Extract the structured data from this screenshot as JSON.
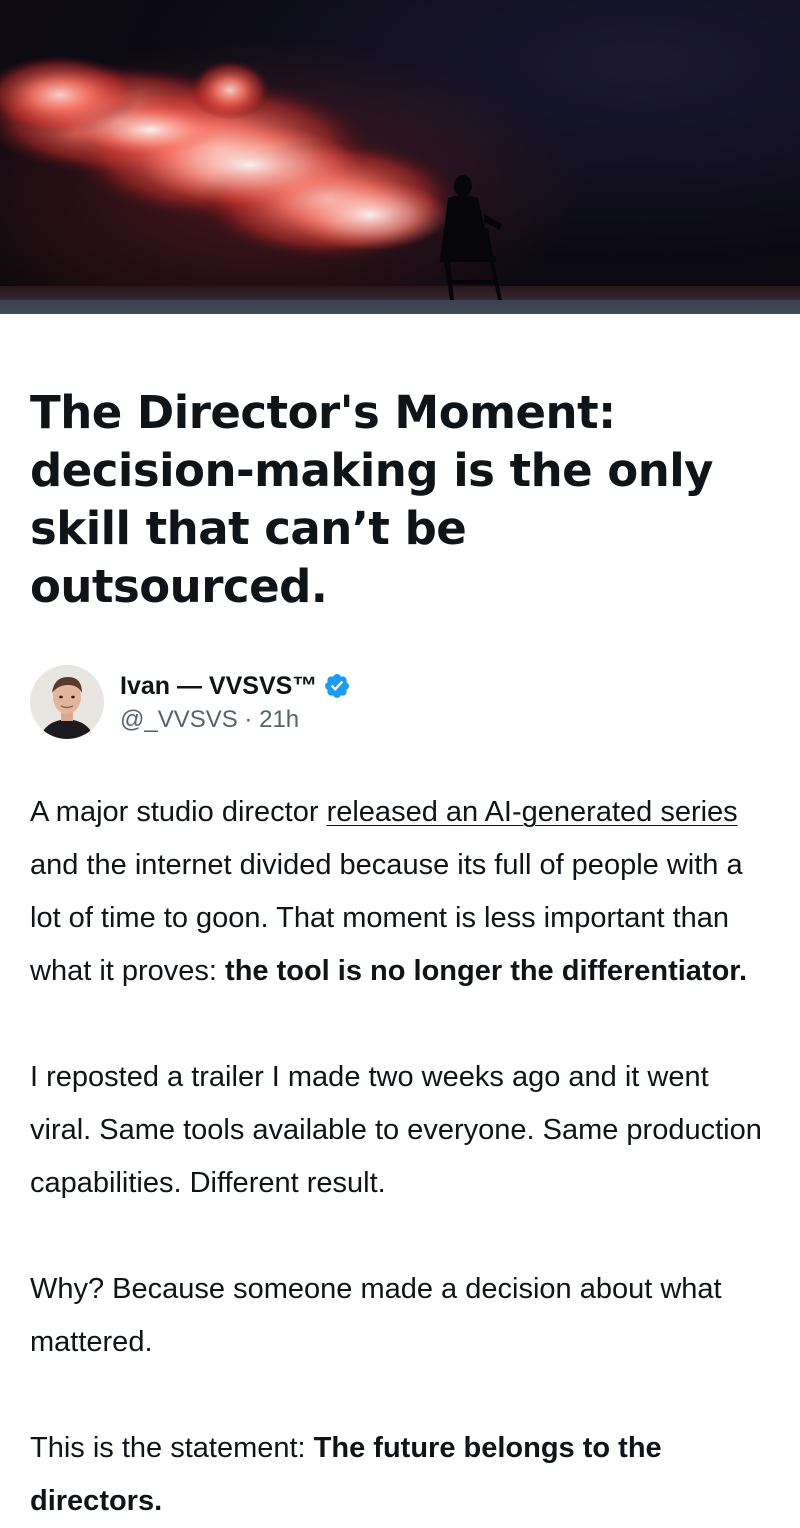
{
  "article": {
    "title": "The Director's Moment: decision-making is the only skill that can’t be outsourced.",
    "author": {
      "name": "Ivan — VVSVS™",
      "handle": "@_VVSVS",
      "separator": "·",
      "time": "21h",
      "verified_icon": "verified-badge-icon"
    },
    "paragraphs": {
      "p1": {
        "t1": "A major studio director ",
        "link": "released an AI-generated series",
        "t2": " and the internet divided because its full of people with a lot of time to goon. That moment is less important than what it proves: ",
        "bold": "the tool is no longer the differentiator."
      },
      "p2": {
        "text": "I reposted a trailer I made two weeks ago and it went viral. Same tools available to everyone. Same production capabilities. Different result."
      },
      "p3": {
        "text": "Why? Because someone made a decision about what mattered."
      },
      "p4": {
        "t1": "This is the statement: ",
        "bold": "The future belongs to the directors."
      }
    }
  },
  "colors": {
    "text": "#0f1419",
    "secondary": "#536471",
    "verified": "#1d9bf0"
  }
}
